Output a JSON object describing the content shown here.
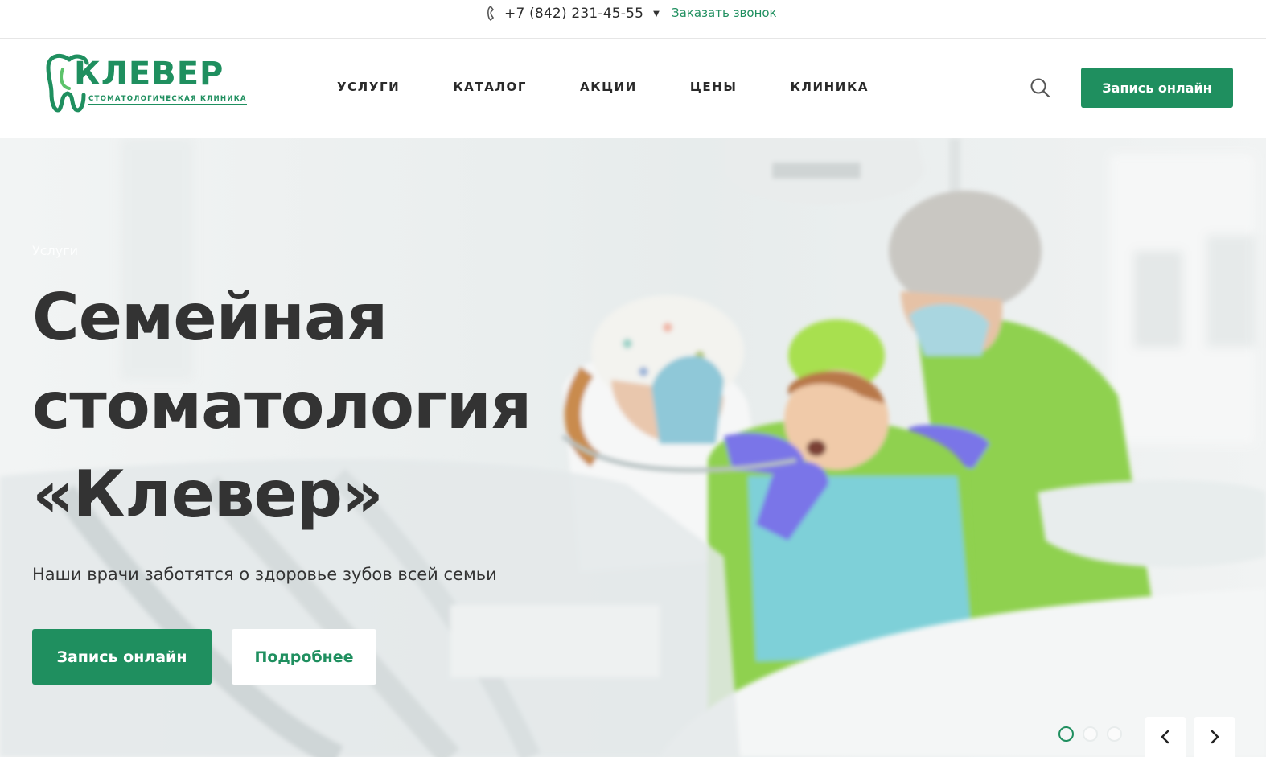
{
  "topbar": {
    "phone": "+7 (842) 231-45-55",
    "callback_label": "Заказать звонок"
  },
  "header": {
    "logo": {
      "brand": "КЛЕВЕР",
      "subtitle": "СТОМАТОЛОГИЧЕСКАЯ КЛИНИКА"
    },
    "nav": [
      "УСЛУГИ",
      "КАТАЛОГ",
      "АКЦИИ",
      "ЦЕНЫ",
      "КЛИНИКА"
    ],
    "cta_label": "Запись онлайн"
  },
  "hero": {
    "breadcrumb": "Услуги",
    "title_lines": [
      "Семейная",
      "стоматология",
      "«Клевер»"
    ],
    "subtitle": "Наши врачи заботятся о здоровье зубов всей семьи",
    "primary_button": "Запись онлайн",
    "secondary_button": "Подробнее",
    "slider": {
      "total": 3,
      "active": 1
    }
  },
  "colors": {
    "brand_green": "#1f8f5f",
    "text_dark": "#333333",
    "scrub_green": "#8fd14f",
    "bib_blue": "#7ed0d8",
    "glove_purple": "#7a75e8"
  },
  "icons": [
    "phone-icon",
    "caret-down-icon",
    "search-icon",
    "tooth-logo-icon",
    "chevron-left-icon",
    "chevron-right-icon"
  ]
}
